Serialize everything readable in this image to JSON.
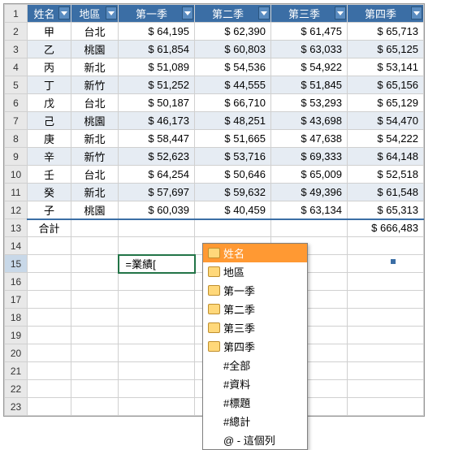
{
  "headers": {
    "name": "姓名",
    "area": "地區",
    "q1": "第一季",
    "q2": "第二季",
    "q3": "第三季",
    "q4": "第四季"
  },
  "rows": [
    {
      "n": "甲",
      "a": "台北",
      "q1": "$  64,195",
      "q2": "$  62,390",
      "q3": "$  61,475",
      "q4": "$  65,713"
    },
    {
      "n": "乙",
      "a": "桃園",
      "q1": "$  61,854",
      "q2": "$  60,803",
      "q3": "$  63,033",
      "q4": "$  65,125"
    },
    {
      "n": "丙",
      "a": "新北",
      "q1": "$  51,089",
      "q2": "$  54,536",
      "q3": "$  54,922",
      "q4": "$  53,141"
    },
    {
      "n": "丁",
      "a": "新竹",
      "q1": "$  51,252",
      "q2": "$  44,555",
      "q3": "$  51,845",
      "q4": "$  65,156"
    },
    {
      "n": "戊",
      "a": "台北",
      "q1": "$  50,187",
      "q2": "$  66,710",
      "q3": "$  53,293",
      "q4": "$  65,129"
    },
    {
      "n": "己",
      "a": "桃園",
      "q1": "$  46,173",
      "q2": "$  48,251",
      "q3": "$  43,698",
      "q4": "$  54,470"
    },
    {
      "n": "庚",
      "a": "新北",
      "q1": "$  58,447",
      "q2": "$  51,665",
      "q3": "$  47,638",
      "q4": "$  54,222"
    },
    {
      "n": "辛",
      "a": "新竹",
      "q1": "$  52,623",
      "q2": "$  53,716",
      "q3": "$  69,333",
      "q4": "$  64,148"
    },
    {
      "n": "壬",
      "a": "台北",
      "q1": "$  64,254",
      "q2": "$  50,646",
      "q3": "$  65,009",
      "q4": "$  52,518"
    },
    {
      "n": "癸",
      "a": "新北",
      "q1": "$  57,697",
      "q2": "$  59,632",
      "q3": "$  49,396",
      "q4": "$  61,548"
    },
    {
      "n": "子",
      "a": "桃園",
      "q1": "$  60,039",
      "q2": "$  40,459",
      "q3": "$  63,134",
      "q4": "$  65,313"
    }
  ],
  "total": {
    "label": "合計",
    "q4": "$ 666,483"
  },
  "formula": "=業績[",
  "rownums": [
    "1",
    "2",
    "3",
    "4",
    "5",
    "6",
    "7",
    "8",
    "9",
    "10",
    "11",
    "12",
    "13",
    "14",
    "15",
    "16",
    "17",
    "18",
    "19",
    "20",
    "21",
    "22",
    "23"
  ],
  "ac": {
    "name": "姓名",
    "area": "地區",
    "q1": "第一季",
    "q2": "第二季",
    "q3": "第三季",
    "q4": "第四季",
    "all": "#全部",
    "data": "#資料",
    "hdr": "#標題",
    "tot": "#總計",
    "this": "@ - 這個列"
  }
}
